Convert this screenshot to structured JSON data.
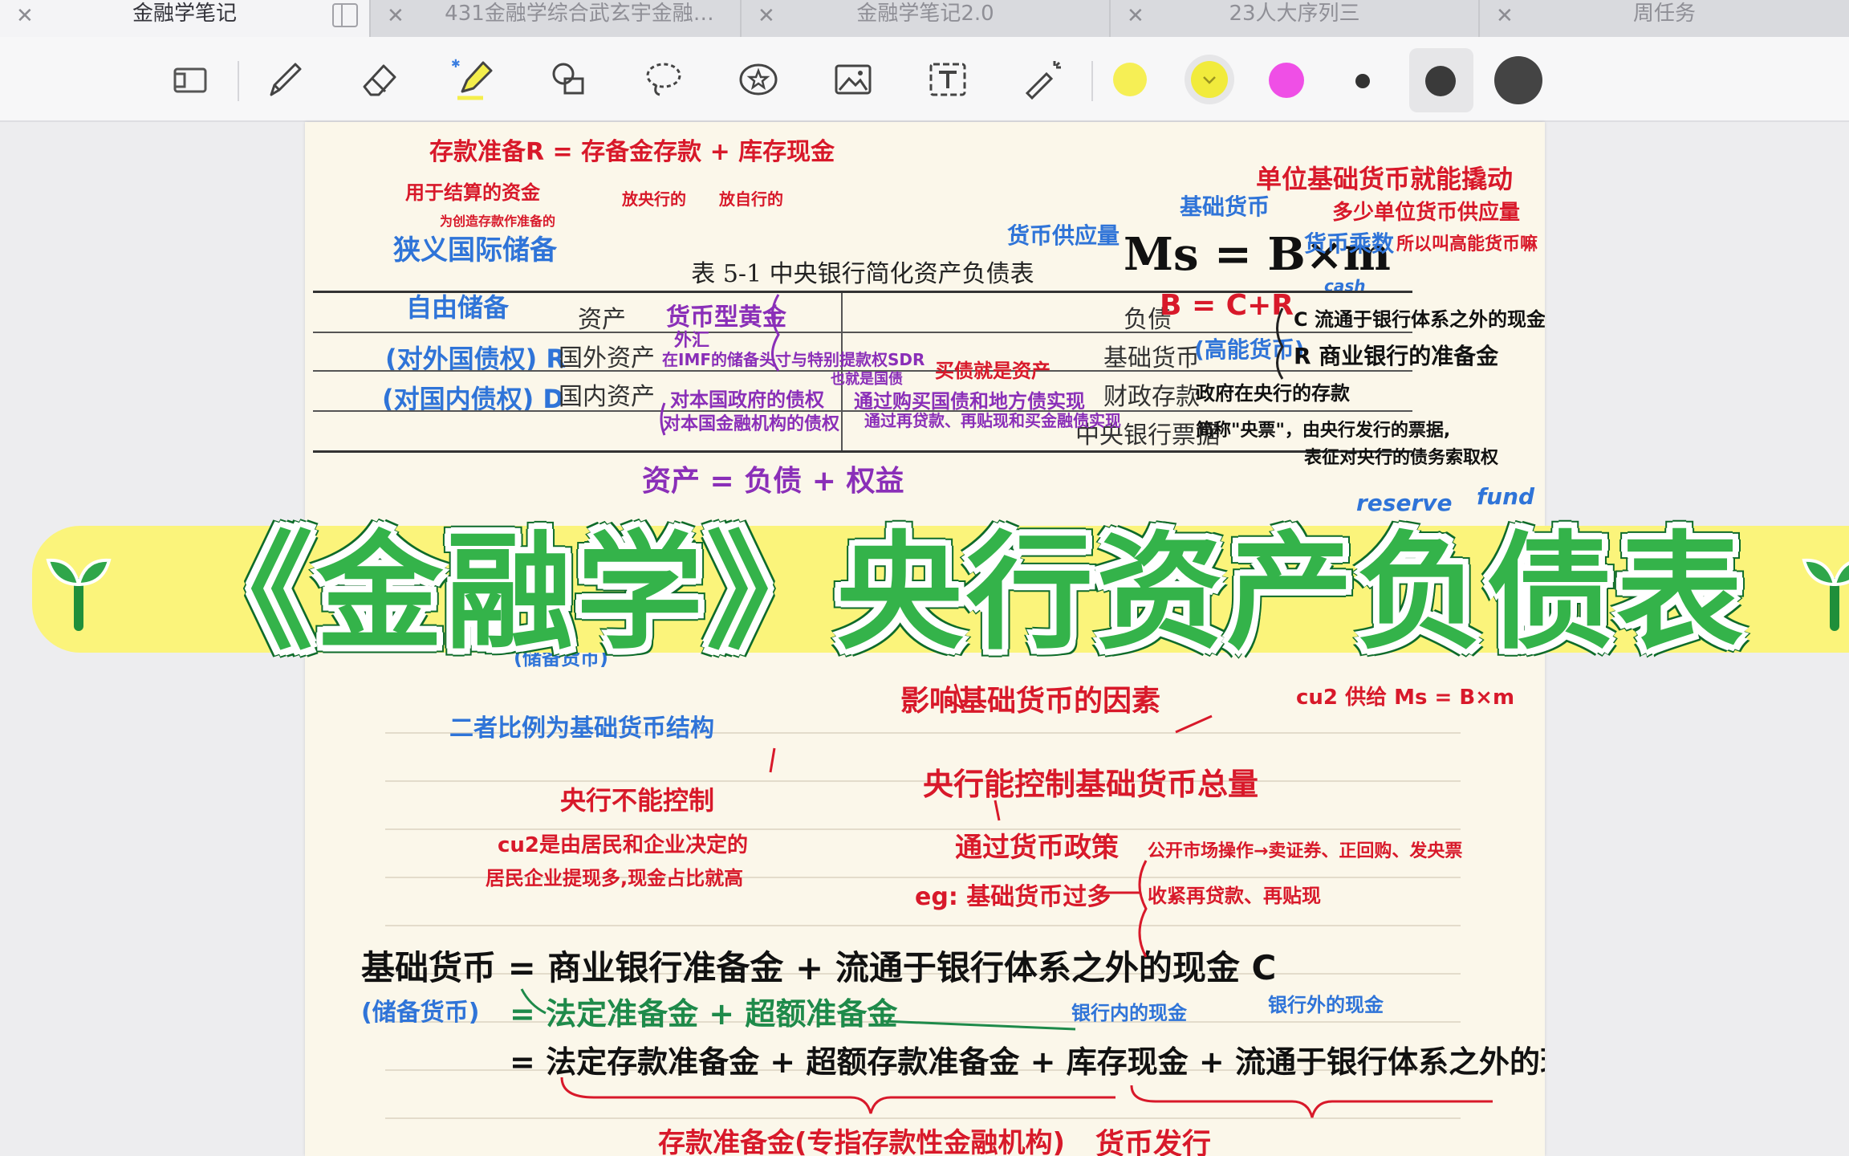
{
  "tabs": [
    {
      "label": "金融学笔记",
      "active": true
    },
    {
      "label": "431金融学综合武玄宇金融…",
      "active": false
    },
    {
      "label": "金融学笔记2.0",
      "active": false
    },
    {
      "label": "23人大序列三",
      "active": false
    },
    {
      "label": "周任务",
      "active": false
    }
  ],
  "toolbar": {
    "tools": [
      "page-view-icon",
      "pen-icon",
      "eraser-icon",
      "highlighter-icon",
      "shapes-icon",
      "lasso-icon",
      "sticker-icon",
      "image-icon",
      "text-icon",
      "laser-pointer-icon"
    ],
    "colors": [
      "#f6ef55",
      "#f1eb3c",
      "#ef4fe6"
    ],
    "sizes": [
      "small",
      "medium",
      "large"
    ]
  },
  "note": {
    "top": {
      "deposit_reserve": "存款准备R = 存备金存款 + 库存现金",
      "deposit_central": "放央行的",
      "deposit_self": "放自行的",
      "for_clearing": "用于结算的资金",
      "for_deposit": "为创造存款作准备的",
      "narrow_reserve": "狭义国际储备",
      "free_reserve": "自由储备",
      "foreign_claim": "(对外国债权) R",
      "domestic_claim": "(对国内债权) D",
      "money_supply": "货币供应量",
      "base_money": "基础货币",
      "formula": "Ms = B×m",
      "multiplier": "货币乘数",
      "unit_drive": "单位基础货币就能撬动",
      "how_many": "多少单位货币供应量",
      "high_power": "所以叫高能货币嘛",
      "cash": "cash",
      "reserve": "reserve",
      "fund": "fund"
    },
    "table": {
      "title": "表 5-1 中央银行简化资产负债表",
      "asset_header": "资产",
      "liability_header": "负债",
      "row1_asset": "国外资产",
      "row2_asset": "国内资产",
      "row1_liab": "基础货币",
      "row2_liab": "财政存款",
      "row3_liab": "中央银行票据"
    },
    "annotations": {
      "gold": "货币型黄金",
      "fx": "外汇",
      "imf": "在IMF的储备头寸与特别提款权SDR",
      "gov_claim": "对本国政府的债权",
      "gov_how": "通过购买国债和地方债实现",
      "gov_also": "也就是国债",
      "buy_debt": "买债就是资产",
      "fin_claim": "对本国金融机构的债权",
      "fin_how": "通过再贷款、再贴现和买金融债实现",
      "b_eq": "B = C+R",
      "high_power_money": "(高能货币)",
      "c_label": "C 流通于银行体系之外的现金",
      "r_label": "R 商业银行的准备金",
      "fiscal": "政府在央行的存款",
      "bill": "简称\"央票\"，由央行发行的票据,",
      "bill2": "表征对央行的债务索取权"
    },
    "mid": {
      "assets_eq": "资产 = 负债 + 权益",
      "ratio": "二者比例为基础货币结构",
      "cannot": "央行不能控制",
      "cu_decided": "cu2是由居民和企业决定的",
      "cash_ratio": "居民企业提现多,现金占比就高",
      "factors": "影响基础货币的因素",
      "cu_supply": "cu2 供给 Ms = B×m",
      "can_control": "央行能控制基础货币总量",
      "via_policy": "通过货币政策",
      "eg": "eg: 基础货币过多",
      "omo": "公开市场操作→卖证券、正回购、发央票",
      "tighten": "收紧再贷款、再贴现",
      "reserve_money": "(储备货币)"
    },
    "bottom": {
      "line1": "基础货币 = 商业银行准备金 + 流通于银行体系之外的现金 C",
      "line2_label": "(储备货币)",
      "line2": "= 法定准备金 + 超额准备金",
      "in_bank_cash": "银行内的现金",
      "out_bank_cash": "银行外的现金",
      "line3": "= 法定存款准备金 + 超额存款准备金 + 库存现金 + 流通于银行体系之外的现金",
      "deposit_reserve": "存款准备金(专指存款性金融机构)",
      "currency_issue": "货币发行"
    }
  },
  "banner": {
    "title": "《金融学》央行资产负债表"
  }
}
